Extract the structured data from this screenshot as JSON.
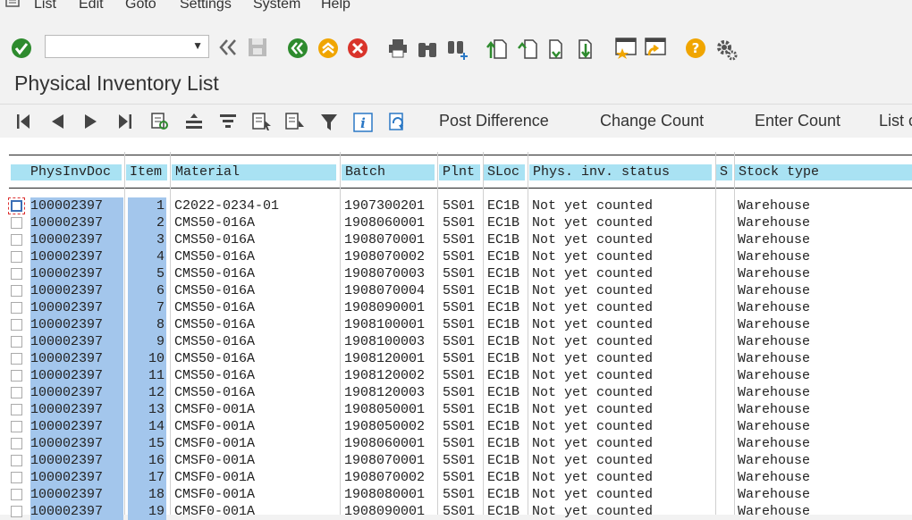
{
  "menu": {
    "items": [
      "List",
      "Edit",
      "Goto",
      "Settings",
      "System",
      "Help"
    ]
  },
  "toolbar": {
    "command_field": "",
    "icons": [
      "enter-check-icon",
      "save-icon",
      "back-icon",
      "exit-icon",
      "cancel-icon",
      "print-icon",
      "find-icon",
      "find-next-icon",
      "first-page-icon",
      "previous-page-icon",
      "next-page-icon",
      "last-page-icon",
      "new-session-icon",
      "shortcut-icon",
      "help-icon",
      "settings-gear-icon"
    ],
    "colors": {
      "green": "#2e8b2e",
      "orange": "#f0a500",
      "red": "#d9342b",
      "help": "#f0a500"
    }
  },
  "page": {
    "title": "Physical Inventory List"
  },
  "app_toolbar": {
    "buttons": [
      "Post Difference",
      "Change Count",
      "Enter Count",
      "List c"
    ]
  },
  "table": {
    "columns": [
      "PhysInvDoc",
      "Item",
      "Material",
      "Batch",
      "Plnt",
      "SLoc",
      "Phys. inv. status",
      "S",
      "Stock type"
    ],
    "rows": [
      [
        "100002397",
        "1",
        "C2022-0234-01",
        "1907300201",
        "5S01",
        "EC1B",
        "Not yet counted",
        "",
        "Warehouse"
      ],
      [
        "100002397",
        "2",
        "CMS50-016A",
        "1908060001",
        "5S01",
        "EC1B",
        "Not yet counted",
        "",
        "Warehouse"
      ],
      [
        "100002397",
        "3",
        "CMS50-016A",
        "1908070001",
        "5S01",
        "EC1B",
        "Not yet counted",
        "",
        "Warehouse"
      ],
      [
        "100002397",
        "4",
        "CMS50-016A",
        "1908070002",
        "5S01",
        "EC1B",
        "Not yet counted",
        "",
        "Warehouse"
      ],
      [
        "100002397",
        "5",
        "CMS50-016A",
        "1908070003",
        "5S01",
        "EC1B",
        "Not yet counted",
        "",
        "Warehouse"
      ],
      [
        "100002397",
        "6",
        "CMS50-016A",
        "1908070004",
        "5S01",
        "EC1B",
        "Not yet counted",
        "",
        "Warehouse"
      ],
      [
        "100002397",
        "7",
        "CMS50-016A",
        "1908090001",
        "5S01",
        "EC1B",
        "Not yet counted",
        "",
        "Warehouse"
      ],
      [
        "100002397",
        "8",
        "CMS50-016A",
        "1908100001",
        "5S01",
        "EC1B",
        "Not yet counted",
        "",
        "Warehouse"
      ],
      [
        "100002397",
        "9",
        "CMS50-016A",
        "1908100003",
        "5S01",
        "EC1B",
        "Not yet counted",
        "",
        "Warehouse"
      ],
      [
        "100002397",
        "10",
        "CMS50-016A",
        "1908120001",
        "5S01",
        "EC1B",
        "Not yet counted",
        "",
        "Warehouse"
      ],
      [
        "100002397",
        "11",
        "CMS50-016A",
        "1908120002",
        "5S01",
        "EC1B",
        "Not yet counted",
        "",
        "Warehouse"
      ],
      [
        "100002397",
        "12",
        "CMS50-016A",
        "1908120003",
        "5S01",
        "EC1B",
        "Not yet counted",
        "",
        "Warehouse"
      ],
      [
        "100002397",
        "13",
        "CMSF0-001A",
        "1908050001",
        "5S01",
        "EC1B",
        "Not yet counted",
        "",
        "Warehouse"
      ],
      [
        "100002397",
        "14",
        "CMSF0-001A",
        "1908050002",
        "5S01",
        "EC1B",
        "Not yet counted",
        "",
        "Warehouse"
      ],
      [
        "100002397",
        "15",
        "CMSF0-001A",
        "1908060001",
        "5S01",
        "EC1B",
        "Not yet counted",
        "",
        "Warehouse"
      ],
      [
        "100002397",
        "16",
        "CMSF0-001A",
        "1908070001",
        "5S01",
        "EC1B",
        "Not yet counted",
        "",
        "Warehouse"
      ],
      [
        "100002397",
        "17",
        "CMSF0-001A",
        "1908070002",
        "5S01",
        "EC1B",
        "Not yet counted",
        "",
        "Warehouse"
      ],
      [
        "100002397",
        "18",
        "CMSF0-001A",
        "1908080001",
        "5S01",
        "EC1B",
        "Not yet counted",
        "",
        "Warehouse"
      ],
      [
        "100002397",
        "19",
        "CMSF0-001A",
        "1908090001",
        "5S01",
        "EC1B",
        "Not yet counted",
        "",
        "Warehouse"
      ]
    ]
  }
}
